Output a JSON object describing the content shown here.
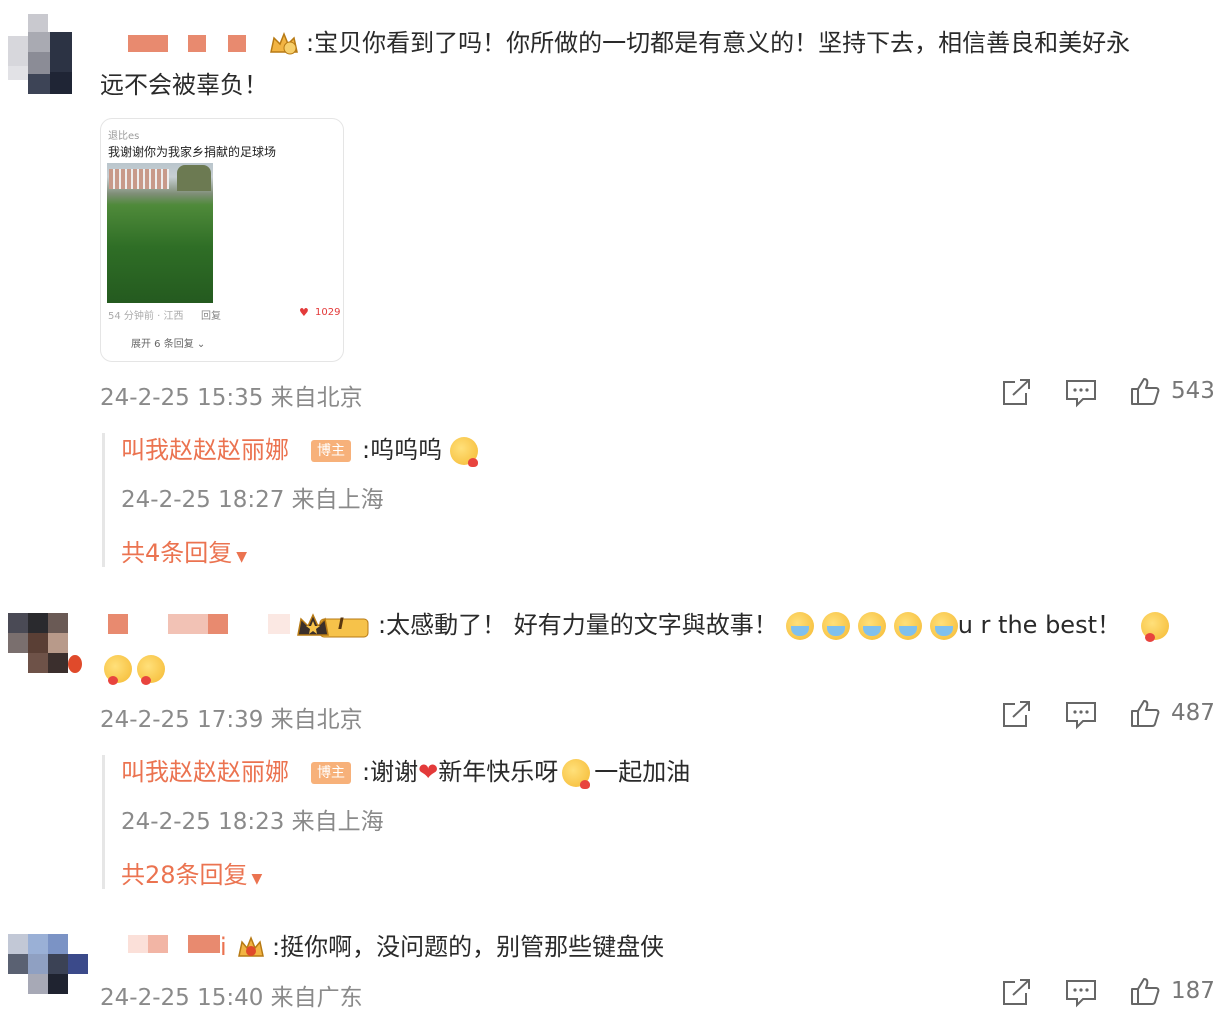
{
  "comments": [
    {
      "text_line1": ":宝贝你看到了吗！你所做的一切都是有意义的！坚持下去，相信善良和美好永",
      "text_line2": "远不会被辜负！",
      "card": {
        "username": "退比es",
        "title": "我谢谢你为我家乡捐献的足球场",
        "time_loc": "54 分钟前 · 江西",
        "reply_label": "回复",
        "likes": "1029",
        "expand": "展开 6 条回复"
      },
      "meta": "24-2-25 15:35 来自北京",
      "likes": "543",
      "reply": {
        "author": "叫我赵赵赵丽娜",
        "badge": "博主",
        "text": ":呜呜呜",
        "meta": "24-2-25 18:27 来自上海",
        "more": "共4条回复"
      }
    },
    {
      "text": ":太感動了！ 好有力量的文字與故事！",
      "text_tail": "u r the best！",
      "meta": "24-2-25 17:39 来自北京",
      "likes": "487",
      "vip_label": "I",
      "reply": {
        "author": "叫我赵赵赵丽娜",
        "badge": "博主",
        "text_a": ":谢谢",
        "text_b": "新年快乐呀",
        "text_c": "一起加油",
        "meta": "24-2-25 18:23 来自上海",
        "more": "共28条回复"
      }
    },
    {
      "name_tail": "i",
      "text": ":挺你啊，没问题的，别管那些键盘侠",
      "meta": "24-2-25 15:40 来自广东",
      "likes": "187"
    }
  ],
  "colors": {
    "accent": "#eb7350",
    "badge": "#f7b17a",
    "meta": "#8a8a8a"
  }
}
